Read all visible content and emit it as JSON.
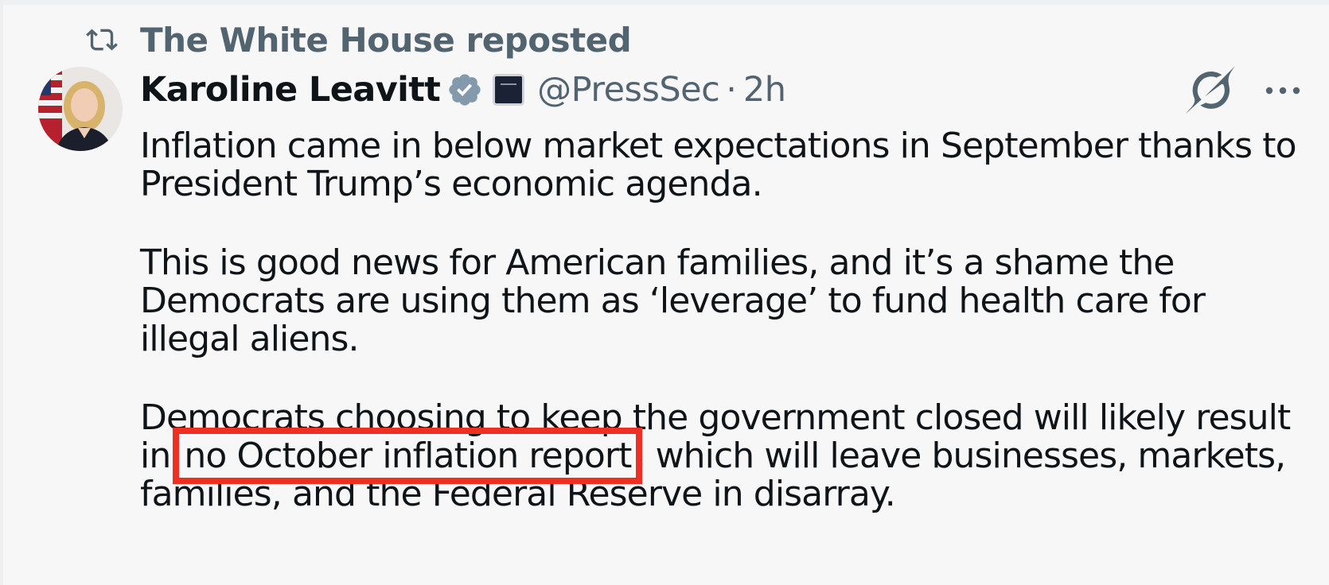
{
  "repost": {
    "icon": "repost-icon",
    "text": "The White House reposted"
  },
  "author": {
    "display_name": "Karoline Leavitt",
    "verified_icon": "verified-badge-icon",
    "affiliate_icon": "white-house-affiliate-icon",
    "handle": "@PressSec",
    "separator": "·",
    "time": "2h"
  },
  "actions": {
    "grok_icon": "grok-icon",
    "more_icon": "more-options-icon"
  },
  "body": {
    "para1": "Inflation came in below market expectations in September thanks to President Trump’s economic agenda.",
    "para2": "This is good news for American families, and it’s a shame the Democrats are using them as ‘leverage’ to fund health care for illegal aliens.",
    "para3_before": "Democrats choosing to keep the government closed will likely result in ",
    "para3_highlight": "no October inflation report",
    "para3_after": ", which will leave businesses, markets, families, and the Federal Reserve in disarray."
  },
  "colors": {
    "text": "#0f1419",
    "muted": "#536471",
    "verified": "#829aab",
    "highlight_box": "#ee3024",
    "background": "#f7f7f8"
  }
}
